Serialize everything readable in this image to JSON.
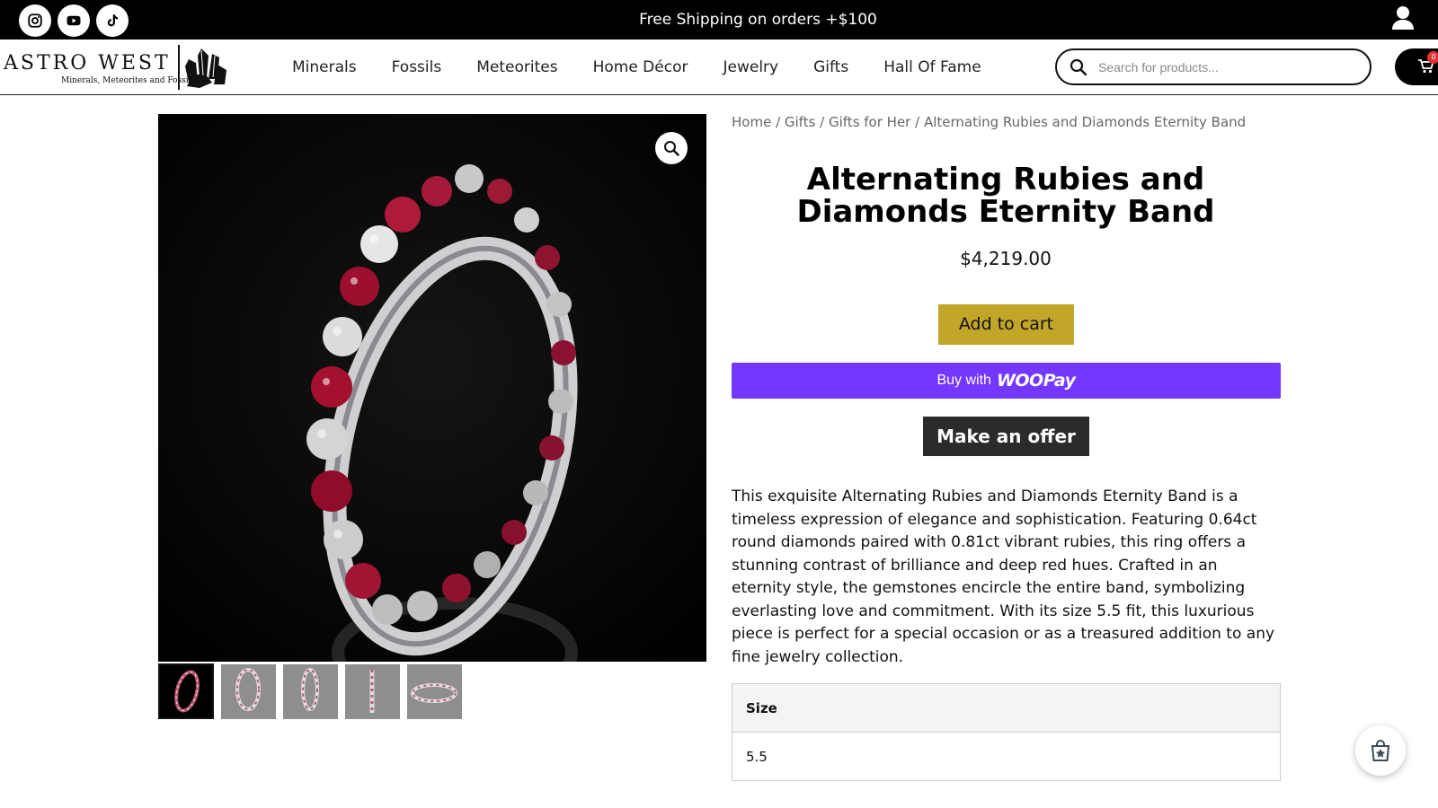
{
  "topbar": {
    "promo": "Free Shipping on orders +$100",
    "social": [
      "instagram-icon",
      "youtube-icon",
      "tiktok-icon"
    ]
  },
  "header": {
    "logo_name": "ASTRO WEST",
    "logo_tagline": "Minerals, Meteorites and Fossils",
    "nav": [
      "Minerals",
      "Fossils",
      "Meteorites",
      "Home Décor",
      "Jewelry",
      "Gifts",
      "Hall Of Fame"
    ],
    "search_placeholder": "Search for products...",
    "cart_count": "0"
  },
  "breadcrumb": {
    "items": [
      "Home",
      "Gifts",
      "Gifts for Her"
    ],
    "current": "Alternating Rubies and Diamonds Eternity Band"
  },
  "product": {
    "title": "Alternating Rubies and Diamonds Eternity Band",
    "price": "$4,219.00",
    "add_to_cart": "Add to cart",
    "woopay_prefix": "Buy with",
    "woopay_brand": "WOOPay",
    "make_offer": "Make an offer",
    "description": "This exquisite Alternating Rubies and Diamonds Eternity Band is a timeless expression of elegance and sophistication. Featuring 0.64ct round diamonds paired with 0.81ct vibrant rubies, this ring offers a stunning contrast of brilliance and deep red hues. Crafted in an eternity style, the gemstones encircle the entire band, symbolizing everlasting love and commitment. With its size 5.5 fit, this luxurious piece is perfect for a special occasion or as a treasured addition to any fine jewelry collection.",
    "size_header": "Size",
    "size_value": "5.5"
  },
  "colors": {
    "topbar": "#000000",
    "add_to_cart": "#c2a629",
    "woopay": "#7337ff",
    "offer": "#2b2b2b",
    "cart_badge": "#dd3333"
  }
}
